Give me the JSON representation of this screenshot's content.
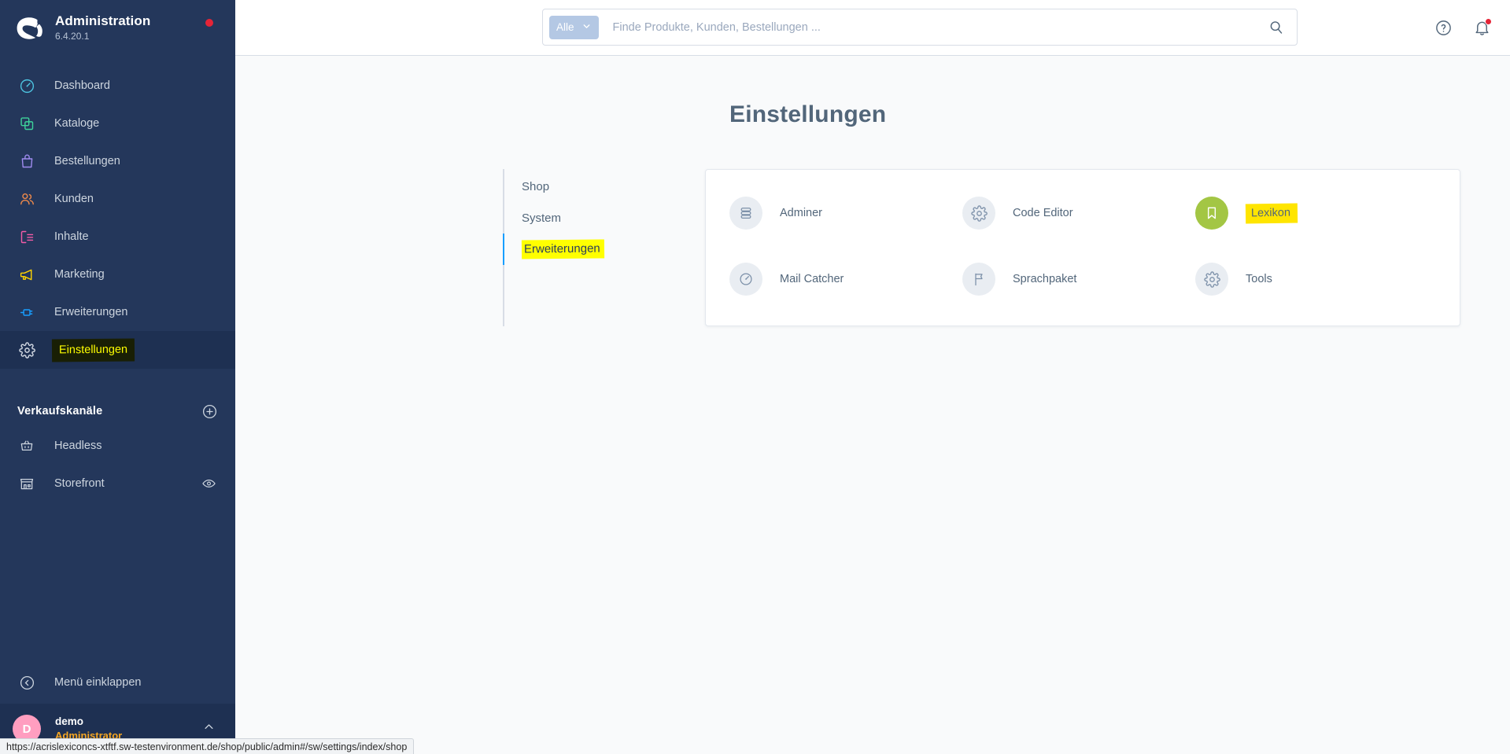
{
  "sidebar": {
    "brand": {
      "title": "Administration",
      "version": "6.4.20.1",
      "logo_icon": "shopware-logo-icon",
      "status_dot": "update-indicator-dot"
    },
    "main_nav": [
      {
        "label": "Dashboard",
        "icon": "dashboard-gauge-icon",
        "color": "#4dc3e0",
        "active": false
      },
      {
        "label": "Kataloge",
        "icon": "catalog-copy-icon",
        "color": "#3ed49b",
        "active": false
      },
      {
        "label": "Bestellungen",
        "icon": "orders-bag-icon",
        "color": "#a08cf0",
        "active": false
      },
      {
        "label": "Kunden",
        "icon": "customers-users-icon",
        "color": "#f08a4b",
        "active": false
      },
      {
        "label": "Inhalte",
        "icon": "content-document-icon",
        "color": "#f45ca8",
        "active": false
      },
      {
        "label": "Marketing",
        "icon": "marketing-megaphone-icon",
        "color": "#ffd400",
        "active": false
      },
      {
        "label": "Erweiterungen",
        "icon": "extensions-plug-icon",
        "color": "#189eff",
        "active": false
      },
      {
        "label": "Einstellungen",
        "icon": "settings-gear-icon",
        "color": "#cdd5df",
        "active": true
      }
    ],
    "sales_channels": {
      "title": "Verkaufskanäle",
      "add_icon": "plus-circle-icon",
      "items": [
        {
          "label": "Headless",
          "icon": "headless-basket-icon",
          "trail_icon": ""
        },
        {
          "label": "Storefront",
          "icon": "storefront-shop-icon",
          "trail_icon": "eye-icon"
        }
      ]
    },
    "collapse": {
      "label": "Menü einklappen",
      "icon": "collapse-chevron-left-icon"
    },
    "user": {
      "initial": "D",
      "name": "demo",
      "role": "Administrator",
      "caret_icon": "chevron-up-icon"
    }
  },
  "topbar": {
    "search": {
      "scope_label": "Alle",
      "scope_caret_icon": "chevron-down-icon",
      "placeholder": "Finde Produkte, Kunden, Bestellungen ...",
      "value": "",
      "submit_icon": "search-icon"
    },
    "help_icon": "help-circle-icon",
    "notifications_icon": "bell-icon",
    "notifications_badge": true
  },
  "page": {
    "title": "Einstellungen",
    "tabs": [
      {
        "label": "Shop",
        "active": false
      },
      {
        "label": "System",
        "active": false
      },
      {
        "label": "Erweiterungen",
        "active": true
      }
    ],
    "extensions": [
      {
        "label": "Adminer",
        "icon": "database-stack-icon",
        "accent": false,
        "highlight": false
      },
      {
        "label": "Code Editor",
        "icon": "gear-icon",
        "accent": false,
        "highlight": false
      },
      {
        "label": "Lexikon",
        "icon": "bookmark-icon",
        "accent": true,
        "highlight": true
      },
      {
        "label": "Mail Catcher",
        "icon": "gauge-icon",
        "accent": false,
        "highlight": false
      },
      {
        "label": "Sprachpaket",
        "icon": "flag-icon",
        "accent": false,
        "highlight": false
      },
      {
        "label": "Tools",
        "icon": "gear-icon",
        "accent": false,
        "highlight": false
      }
    ]
  },
  "status_bar": {
    "url": "https://acrislexiconcs-xtftf.sw-testenvironment.de/shop/public/admin#/sw/settings/index/shop"
  },
  "colors": {
    "sidebar_bg": "#24375b",
    "sidebar_active_bg": "#1e3052",
    "accent_blue": "#189eff",
    "accent_green": "#a3c644",
    "highlight_yellow": "#ffe500",
    "danger_red": "#e52437",
    "avatar_pink": "#ff9ec0",
    "role_orange": "#f5a623"
  }
}
